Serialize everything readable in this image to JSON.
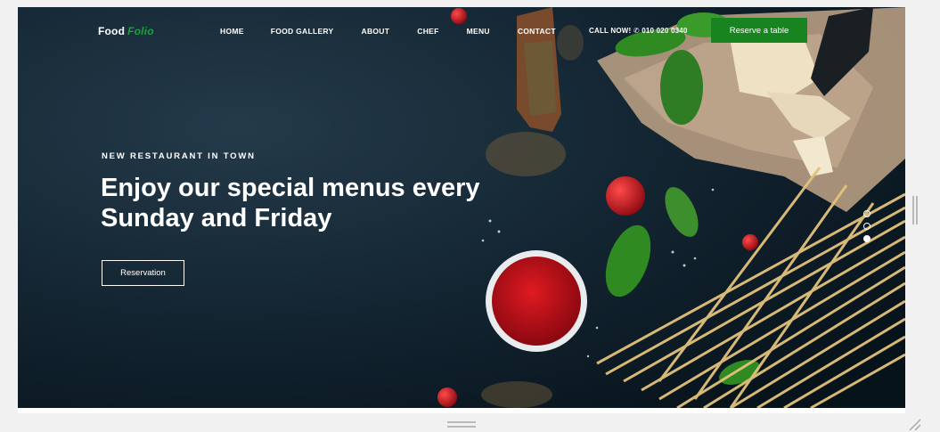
{
  "brand": {
    "name": "Food",
    "accent": "Folio",
    "accent_color": "#1aa33a"
  },
  "nav": {
    "items": [
      "HOME",
      "FOOD GALLERY",
      "ABOUT",
      "CHEF",
      "MENU",
      "CONTACT"
    ],
    "call_label": "CALL NOW!",
    "phone_icon": "phone-icon",
    "phone": "010 020 0340",
    "reserve_label": "Reserve a table",
    "reserve_color": "#17841f"
  },
  "hero": {
    "eyebrow": "NEW RESTAURANT IN TOWN",
    "headline_line1": "Enjoy our special menus every",
    "headline_line2": "Sunday and Friday",
    "button_label": "Reservation"
  },
  "slider": {
    "count": 3,
    "active_index": 3
  }
}
